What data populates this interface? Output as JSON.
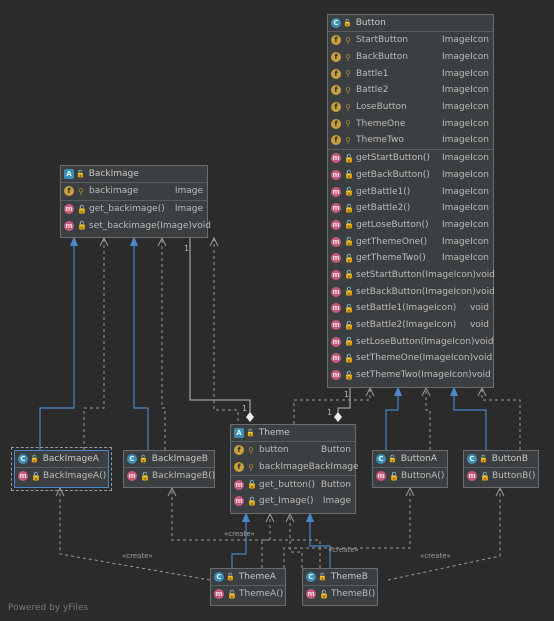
{
  "classes": {
    "button": {
      "title": "Button",
      "fields": [
        {
          "name": "StartButton",
          "type": "ImageIcon"
        },
        {
          "name": "BackButton",
          "type": "ImageIcon"
        },
        {
          "name": "Battle1",
          "type": "ImageIcon"
        },
        {
          "name": "Battle2",
          "type": "ImageIcon"
        },
        {
          "name": "LoseButton",
          "type": "ImageIcon"
        },
        {
          "name": "ThemeOne",
          "type": "ImageIcon"
        },
        {
          "name": "ThemeTwo",
          "type": "ImageIcon"
        }
      ],
      "methods": [
        {
          "name": "getStartButton()",
          "type": "ImageIcon"
        },
        {
          "name": "getBackButton()",
          "type": "ImageIcon"
        },
        {
          "name": "getBattle1()",
          "type": "ImageIcon"
        },
        {
          "name": "getBattle2()",
          "type": "ImageIcon"
        },
        {
          "name": "getLoseButton()",
          "type": "ImageIcon"
        },
        {
          "name": "getThemeOne()",
          "type": "ImageIcon"
        },
        {
          "name": "getThemeTwo()",
          "type": "ImageIcon"
        },
        {
          "name": "setStartButton(ImageIcon)",
          "type": "void"
        },
        {
          "name": "setBackButton(ImageIcon)",
          "type": "void"
        },
        {
          "name": "setBattle1(ImageIcon)",
          "type": "void"
        },
        {
          "name": "setBattle2(ImageIcon)",
          "type": "void"
        },
        {
          "name": "setLoseButton(ImageIcon)",
          "type": "void"
        },
        {
          "name": "setThemeOne(ImageIcon)",
          "type": "void"
        },
        {
          "name": "setThemeTwo(ImageIcon)",
          "type": "void"
        }
      ]
    },
    "backimage": {
      "title": "BackImage",
      "fields": [
        {
          "name": "backimage",
          "type": "Image"
        }
      ],
      "methods": [
        {
          "name": "get_backimage()",
          "type": "Image"
        },
        {
          "name": "set_backimage(Image)",
          "type": "void"
        }
      ]
    },
    "backimagea": {
      "title": "BackImageA",
      "methods": [
        {
          "name": "BackImageA()",
          "type": ""
        }
      ]
    },
    "backimageb": {
      "title": "BackImageB",
      "methods": [
        {
          "name": "BackImageB()",
          "type": ""
        }
      ]
    },
    "theme": {
      "title": "Theme",
      "fields": [
        {
          "name": "button",
          "type": "Button"
        },
        {
          "name": "backImage",
          "type": "BackImage"
        }
      ],
      "methods": [
        {
          "name": "get_button()",
          "type": "Button"
        },
        {
          "name": "get_Image()",
          "type": "Image"
        }
      ]
    },
    "buttona": {
      "title": "ButtonA",
      "methods": [
        {
          "name": "ButtonA()",
          "type": ""
        }
      ]
    },
    "buttonb": {
      "title": "ButtonB",
      "methods": [
        {
          "name": "ButtonB()",
          "type": ""
        }
      ]
    },
    "themea": {
      "title": "ThemeA",
      "methods": [
        {
          "name": "ThemeA()",
          "type": ""
        }
      ]
    },
    "themeb": {
      "title": "ThemeB",
      "methods": [
        {
          "name": "ThemeB()",
          "type": ""
        }
      ]
    }
  },
  "labels": {
    "create": "«create»",
    "mult_one": "1"
  },
  "footer": "Powered by yFiles",
  "colors": {
    "background": "#2b2b2b",
    "box": "#3c3f41",
    "inheritance": "#4a88c7",
    "dependency": "#9a9a9a",
    "association": "#bbbbbb"
  }
}
